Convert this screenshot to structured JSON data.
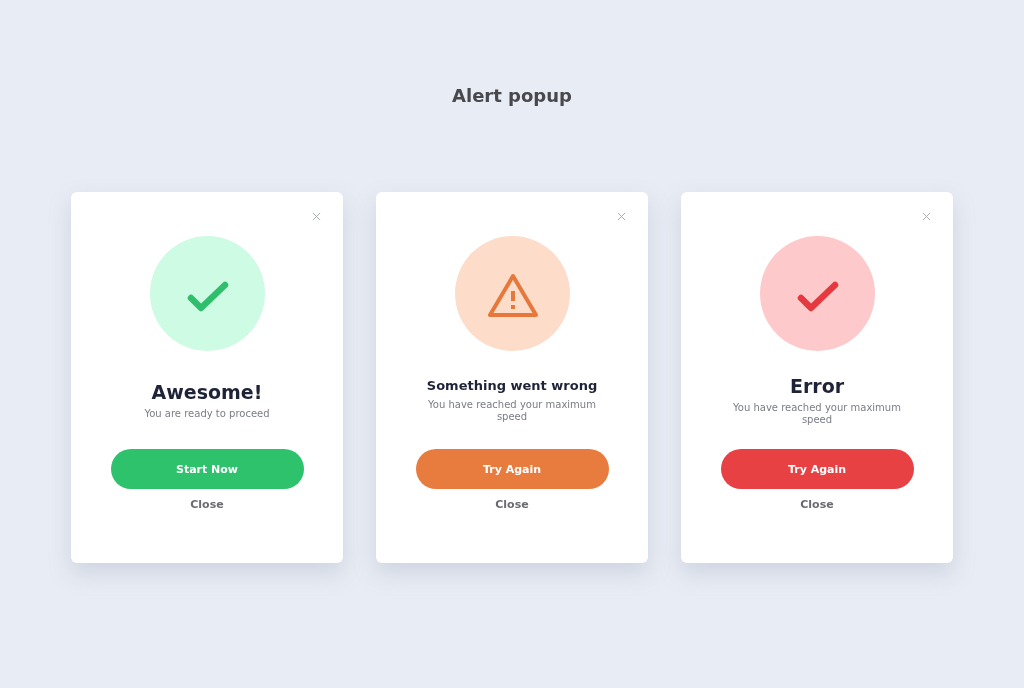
{
  "page": {
    "title": "Alert popup"
  },
  "cards": [
    {
      "kind": "success",
      "title": "Awesome!",
      "message": "You are ready to proceed",
      "primary_button": "Start Now",
      "secondary_button": "Close"
    },
    {
      "kind": "warning",
      "title": "Something went wrong",
      "message": "You have reached your maximum speed",
      "primary_button": "Try Again",
      "secondary_button": "Close"
    },
    {
      "kind": "error",
      "title": "Error",
      "message": "You have reached your maximum speed",
      "primary_button": "Try Again",
      "secondary_button": "Close"
    }
  ]
}
